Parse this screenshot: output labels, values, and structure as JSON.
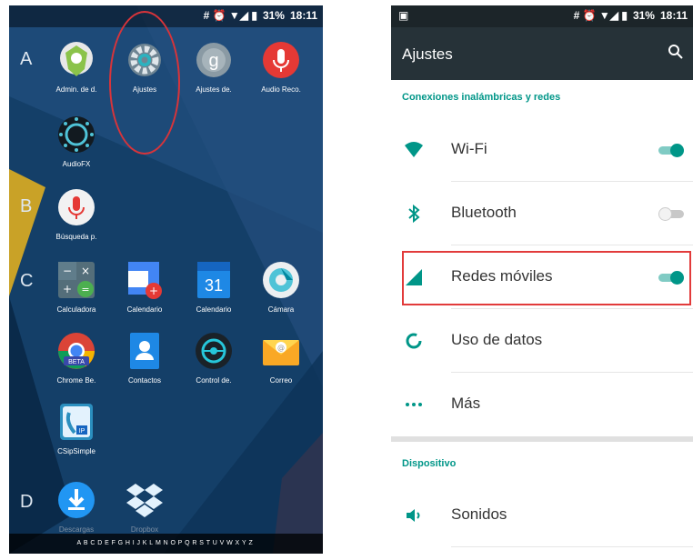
{
  "left_phone": {
    "status_bar": {
      "battery": "31%",
      "time": "18:11"
    },
    "letters": [
      "A",
      "B",
      "C",
      "D"
    ],
    "apps": [
      {
        "label": "Admin. de d.",
        "icon": "android-shield-icon"
      },
      {
        "label": "Ajustes",
        "icon": "settings-gear-icon"
      },
      {
        "label": "Ajustes de.",
        "icon": "google-settings-icon"
      },
      {
        "label": "Audio Reco.",
        "icon": "microphone-icon"
      },
      {
        "label": "AudioFX",
        "icon": "audiofx-icon"
      },
      {
        "label": "Búsqueda p.",
        "icon": "voice-search-icon"
      },
      {
        "label": "Calculadora",
        "icon": "calculator-icon"
      },
      {
        "label": "Calendario",
        "icon": "calendar-plus-icon"
      },
      {
        "label": "Calendario",
        "icon": "calendar-31-icon",
        "calendar_day": "31"
      },
      {
        "label": "Cámara",
        "icon": "camera-icon"
      },
      {
        "label": "Chrome Be.",
        "icon": "chrome-beta-icon",
        "badge": "BETA"
      },
      {
        "label": "Contactos",
        "icon": "contacts-icon"
      },
      {
        "label": "Control de.",
        "icon": "control-icon"
      },
      {
        "label": "Correo",
        "icon": "mail-icon"
      },
      {
        "label": "CSipSimple",
        "icon": "csipsimple-icon",
        "badge": "IP"
      },
      {
        "label": "Descargas",
        "icon": "download-icon"
      },
      {
        "label": "Dropbox",
        "icon": "dropbox-icon"
      }
    ],
    "alphabet": "ABCDEFGHIJKLMNOPQRSTUVWXYZ"
  },
  "right_phone": {
    "status_bar": {
      "battery": "31%",
      "time": "18:11"
    },
    "toolbar": {
      "title": "Ajustes"
    },
    "sections": {
      "wireless": "Conexiones inalámbricas y redes",
      "device": "Dispositivo"
    },
    "rows": [
      {
        "label": "Wi-Fi",
        "icon": "wifi-icon",
        "toggle": "on"
      },
      {
        "label": "Bluetooth",
        "icon": "bluetooth-icon",
        "toggle": "off"
      },
      {
        "label": "Redes móviles",
        "icon": "cellular-icon",
        "toggle": "on"
      },
      {
        "label": "Uso de datos",
        "icon": "data-usage-icon"
      },
      {
        "label": "Más",
        "icon": "more-dots-icon"
      },
      {
        "label": "Sonidos",
        "icon": "sound-icon"
      }
    ]
  },
  "colors": {
    "accent": "#009688",
    "toolbar": "#263238",
    "highlight": "#e23b3b"
  }
}
